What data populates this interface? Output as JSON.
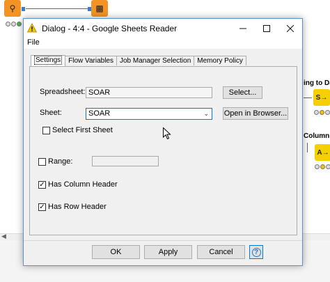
{
  "dialog": {
    "title": "Dialog - 4:4 - Google Sheets Reader",
    "menu_file": "File"
  },
  "tabs": [
    {
      "label": "Settings",
      "active": true
    },
    {
      "label": "Flow Variables"
    },
    {
      "label": "Job Manager Selection"
    },
    {
      "label": "Memory Policy"
    }
  ],
  "settings": {
    "spreadsheet_label": "Spreadsheet:",
    "spreadsheet_value": "SOAR",
    "select_button": "Select...",
    "sheet_label": "Sheet:",
    "sheet_value": "SOAR",
    "open_browser_button": "Open in Browser...",
    "select_first_sheet_label": "Select First Sheet",
    "select_first_sheet_checked": false,
    "range_label": "Range:",
    "range_value": "",
    "range_checked": false,
    "has_column_header_label": "Has Column Header",
    "has_column_header_checked": true,
    "has_row_header_label": "Has Row Header",
    "has_row_header_checked": true
  },
  "footer": {
    "ok": "OK",
    "apply": "Apply",
    "cancel": "Cancel",
    "help": "?"
  },
  "background": {
    "label_top_right": "ing to Date",
    "label_mid_right": "Column Re"
  },
  "colors": {
    "warning_icon": "#f2c500",
    "accent": "#0078d7",
    "node_orange": "#f39323",
    "node_yellow": "#f4d000"
  },
  "icons": {
    "title_icon": "warning-triangle-icon",
    "minimize": "minimize-icon",
    "maximize": "maximize-icon",
    "close": "close-icon",
    "help": "help-icon"
  }
}
